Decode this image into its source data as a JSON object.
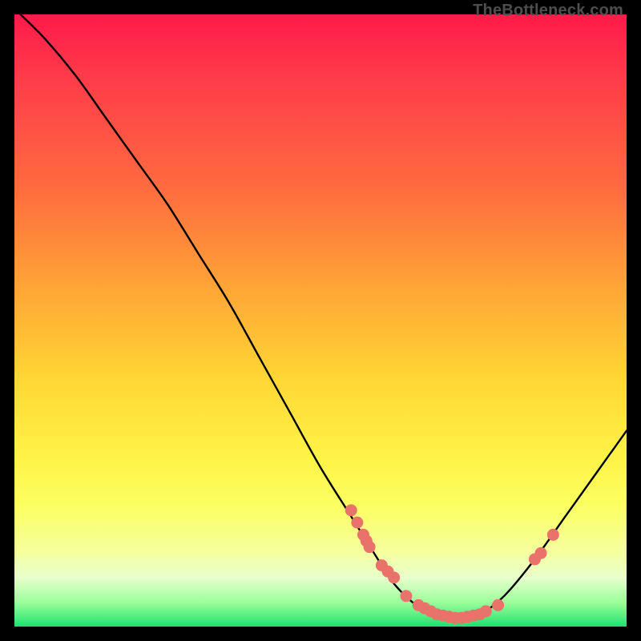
{
  "attribution": "TheBottleneck.com",
  "colors": {
    "curve": "#000000",
    "dots": "#e9726b",
    "frame_border": "#000000"
  },
  "chart_data": {
    "type": "line",
    "title": "",
    "xlabel": "",
    "ylabel": "",
    "xlim": [
      0,
      100
    ],
    "ylim": [
      0,
      100
    ],
    "series": [
      {
        "name": "curve",
        "x": [
          1,
          5,
          10,
          15,
          20,
          25,
          30,
          35,
          40,
          45,
          50,
          55,
          60,
          62,
          65,
          68,
          72,
          76,
          80,
          85,
          90,
          95,
          100
        ],
        "y": [
          100,
          96,
          90,
          83,
          76,
          69,
          61,
          53,
          44,
          35,
          26,
          18,
          10,
          7,
          4,
          2,
          1,
          2,
          5,
          11,
          18,
          25,
          32
        ]
      }
    ],
    "markers": {
      "name": "dots",
      "x": [
        55,
        56,
        57,
        57.5,
        58,
        60,
        61,
        62,
        64,
        66,
        67,
        68,
        69,
        70,
        71,
        72,
        73,
        74,
        75,
        76,
        77,
        79,
        85,
        86,
        88
      ],
      "y": [
        19,
        17,
        15,
        14,
        13,
        10,
        9,
        8,
        5,
        3.5,
        3,
        2.5,
        2,
        1.8,
        1.6,
        1.4,
        1.4,
        1.6,
        1.8,
        2,
        2.5,
        3.5,
        11,
        12,
        15
      ]
    }
  }
}
